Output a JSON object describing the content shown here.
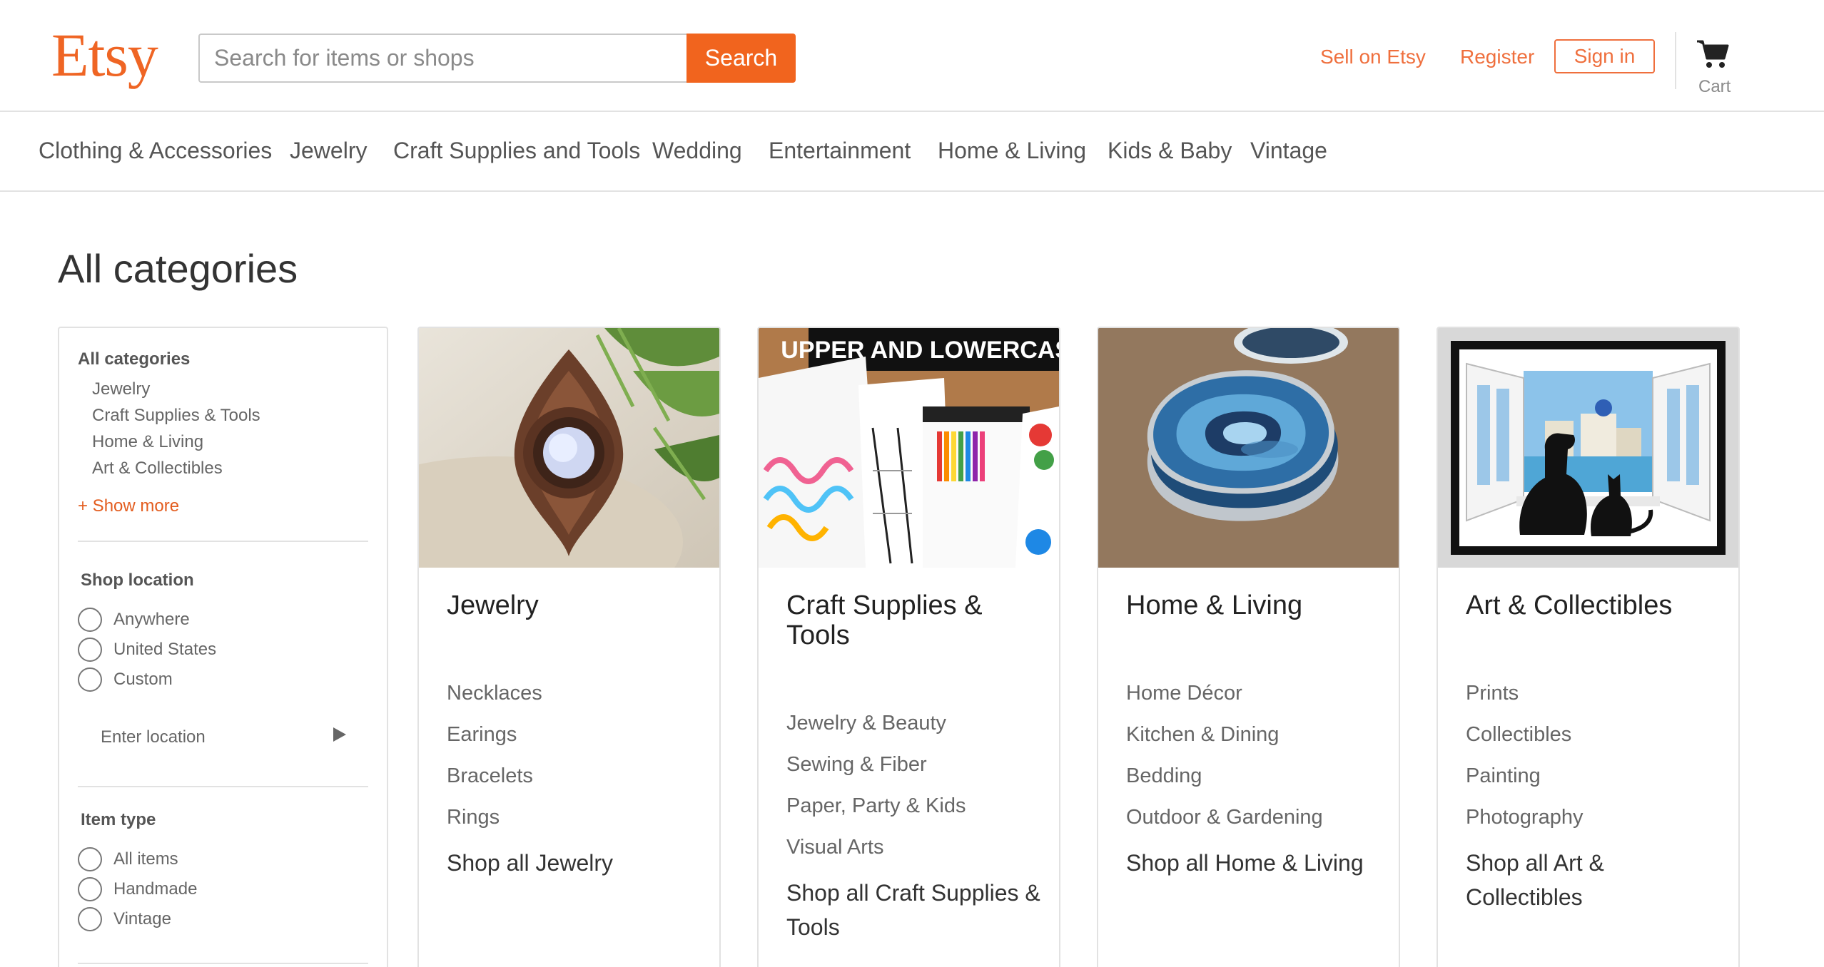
{
  "header": {
    "logo": "Etsy",
    "search_placeholder": "Search for items or shops",
    "search_button": "Search",
    "sell_link": "Sell on Etsy",
    "register_link": "Register",
    "signin_button": "Sign in",
    "cart_label": "Cart",
    "cart_icon": "cart-icon"
  },
  "category_nav": [
    "Clothing & Accessories",
    "Jewelry",
    "Craft Supplies and Tools",
    "Wedding",
    "Entertainment",
    "Home & Living",
    "Kids & Baby",
    "Vintage"
  ],
  "page_title": "All categories",
  "sidebar": {
    "categories_heading": "All categories",
    "categories": [
      "Jewelry",
      "Craft Supplies & Tools",
      "Home & Living",
      "Art & Collectibles"
    ],
    "show_more": "+ Show more",
    "shop_location": {
      "heading": "Shop location",
      "options": [
        "Anywhere",
        "United States",
        "Custom"
      ],
      "location_placeholder": "Enter location"
    },
    "item_type": {
      "heading": "Item type",
      "options": [
        "All items",
        "Handmade",
        "Vintage"
      ]
    }
  },
  "cards": [
    {
      "title": "Jewelry",
      "image": "jewelry-pendant-image",
      "links": [
        "Necklaces",
        "Earings",
        "Bracelets",
        "Rings"
      ],
      "shop_all": "Shop all Jewelry"
    },
    {
      "title": "Craft Supplies & Tools",
      "image": "lettering-worksheets-image",
      "image_text": "UPPER AND LOWERCASE",
      "links": [
        "Jewelry & Beauty",
        "Sewing & Fiber",
        "Paper, Party & Kids",
        "Visual Arts"
      ],
      "shop_all": "Shop all Craft Supplies & Tools"
    },
    {
      "title": "Home & Living",
      "image": "agate-coasters-image",
      "links": [
        "Home Décor",
        "Kitchen & Dining",
        "Bedding",
        "Outdoor & Gardening"
      ],
      "shop_all": "Shop all Home & Living"
    },
    {
      "title": "Art & Collectibles",
      "image": "dog-cat-window-art-image",
      "links": [
        "Prints",
        "Collectibles",
        "Painting",
        "Photography"
      ],
      "shop_all": "Shop all Art & Collectibles"
    }
  ],
  "colors": {
    "brand": "#f1641e",
    "link_orange": "#ef6f3d",
    "border": "#e2e2e2"
  }
}
